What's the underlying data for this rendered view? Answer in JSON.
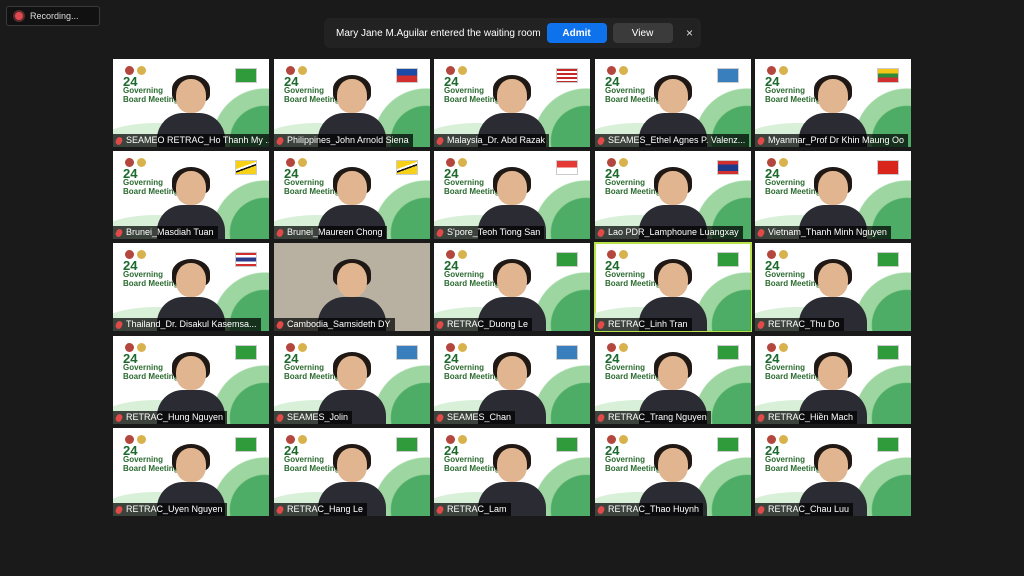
{
  "recording": {
    "label": "Recording..."
  },
  "waiting_room": {
    "message": "Mary Jane M.Aguilar entered the waiting room",
    "admit_label": "Admit",
    "view_label": "View",
    "close_symbol": "×"
  },
  "tiles": [
    {
      "name": "SEAMEO RETRAC_Ho Thanh My ...",
      "flag": "retrac",
      "bg": "slide"
    },
    {
      "name": "Philippines_John Arnold Siena",
      "flag": "philippines",
      "bg": "slide"
    },
    {
      "name": "Malaysia_Dr. Abd Razak",
      "flag": "malaysia",
      "bg": "slide"
    },
    {
      "name": "SEAMES_Ethel Agnes P. Valenz...",
      "flag": "seames",
      "bg": "slide"
    },
    {
      "name": "Myanmar_Prof Dr Khin Maung Oo",
      "flag": "myanmar",
      "bg": "slide"
    },
    {
      "name": "Brunei_Masdiah Tuan",
      "flag": "brunei",
      "bg": "slide"
    },
    {
      "name": "Brunei_Maureen Chong",
      "flag": "brunei",
      "bg": "slide"
    },
    {
      "name": "S'pore_Teoh Tiong San",
      "flag": "singapore",
      "bg": "slide"
    },
    {
      "name": "Lao PDR_Lamphoune Luangxay",
      "flag": "laos",
      "bg": "slide"
    },
    {
      "name": "Vietnam_Thanh Minh Nguyen",
      "flag": "vietnam",
      "bg": "slide"
    },
    {
      "name": "Thailand_Dr. Disakul Kasemsa...",
      "flag": "thailand",
      "bg": "slide"
    },
    {
      "name": "Cambodia_Samsideth DY",
      "flag": "",
      "bg": "photo"
    },
    {
      "name": "RETRAC_Duong Le",
      "flag": "retrac",
      "bg": "slide"
    },
    {
      "name": "RETRAC_Linh Tran",
      "flag": "retrac",
      "bg": "slide",
      "active": true
    },
    {
      "name": "RETRAC_Thu Do",
      "flag": "retrac",
      "bg": "slide"
    },
    {
      "name": "RETRAC_Hung Nguyen",
      "flag": "retrac",
      "bg": "slide"
    },
    {
      "name": "SEAMES_Jolin",
      "flag": "seames",
      "bg": "slide"
    },
    {
      "name": "SEAMES_Chan",
      "flag": "seames",
      "bg": "slide"
    },
    {
      "name": "RETRAC_Trang Nguyen",
      "flag": "retrac",
      "bg": "slide"
    },
    {
      "name": "RETRAC_Hiền Mach",
      "flag": "retrac",
      "bg": "slide"
    },
    {
      "name": "RETRAC_Uyen Nguyen",
      "flag": "retrac",
      "bg": "slide"
    },
    {
      "name": "RETRAC_Hang Le",
      "flag": "retrac",
      "bg": "slide"
    },
    {
      "name": "RETRAC_Lam",
      "flag": "retrac",
      "bg": "slide"
    },
    {
      "name": "RETRAC_Thao Huynh",
      "flag": "retrac",
      "bg": "slide"
    },
    {
      "name": "RETRAC_Chau Luu",
      "flag": "retrac",
      "bg": "slide"
    }
  ],
  "slide_text": {
    "line1": "24",
    "line2": "Governing",
    "line3": "Board Meeting"
  },
  "colors": {
    "admit": "#0e72ed",
    "active_speaker": "#b8e34a",
    "muted_mic": "#e24a4a"
  }
}
